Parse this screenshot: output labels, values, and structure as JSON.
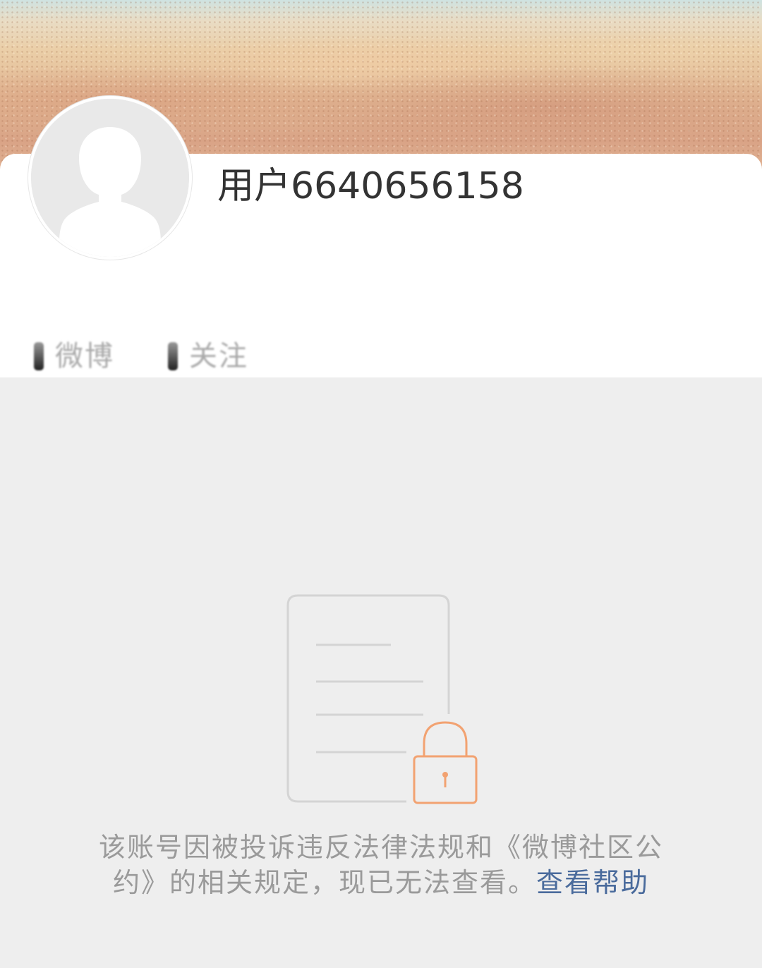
{
  "profile": {
    "username": "用户6640656158",
    "stats_blurred": [
      "微博",
      "关注"
    ]
  },
  "notice": {
    "message": "该账号因被投诉违反法律法规和《微博社区公约》的相关规定，现已无法查看。",
    "help_link_label": "查看帮助"
  },
  "colors": {
    "background": "#eeeeee",
    "card": "#ffffff",
    "text_primary": "#333333",
    "text_secondary": "#9a9a9a",
    "link": "#4a6b9c",
    "lock_accent": "#f2a271"
  },
  "icons": {
    "avatar": "default-avatar-icon",
    "locked_document": "locked-document-icon"
  }
}
